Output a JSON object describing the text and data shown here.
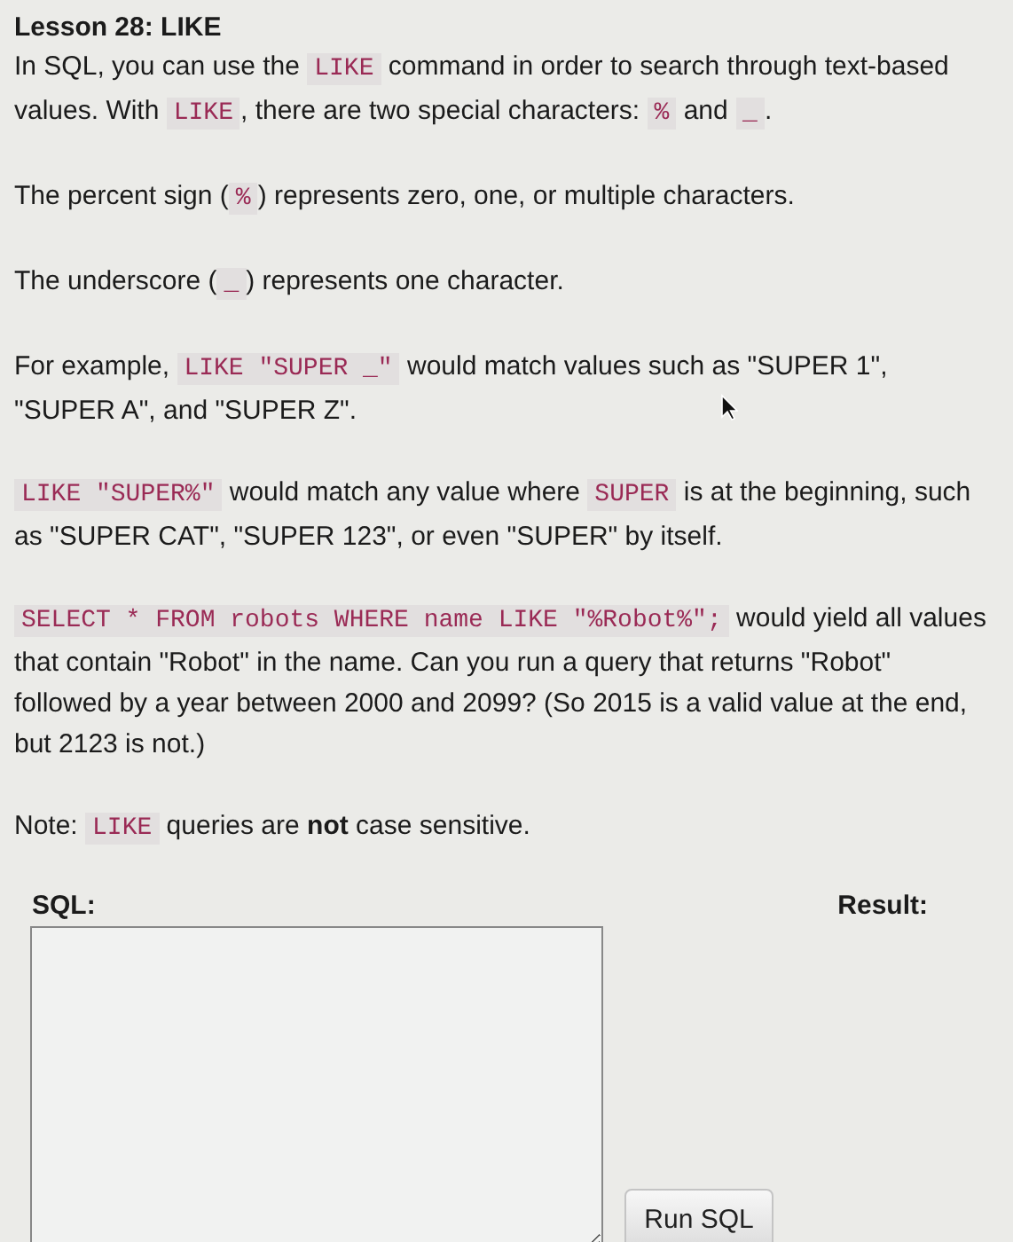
{
  "title": "Lesson 28: LIKE",
  "paragraphs": [
    {
      "segments": [
        {
          "kind": "text",
          "text": "In SQL, you can use the "
        },
        {
          "kind": "code",
          "text": "LIKE"
        },
        {
          "kind": "text",
          "text": " command in order to search through text-based values. With "
        },
        {
          "kind": "code",
          "text": "LIKE"
        },
        {
          "kind": "text",
          "text": ", there are two special characters: "
        },
        {
          "kind": "code",
          "text": "%"
        },
        {
          "kind": "text",
          "text": " and "
        },
        {
          "kind": "code",
          "text": "_"
        },
        {
          "kind": "text",
          "text": "."
        }
      ]
    },
    {
      "segments": [
        {
          "kind": "text",
          "text": "The percent sign ("
        },
        {
          "kind": "code",
          "text": "%"
        },
        {
          "kind": "text",
          "text": ") represents zero, one, or multiple characters."
        }
      ]
    },
    {
      "segments": [
        {
          "kind": "text",
          "text": "The underscore ("
        },
        {
          "kind": "code",
          "text": "_"
        },
        {
          "kind": "text",
          "text": ") represents one character."
        }
      ]
    },
    {
      "segments": [
        {
          "kind": "text",
          "text": "For example, "
        },
        {
          "kind": "code",
          "text": "LIKE \"SUPER _\""
        },
        {
          "kind": "text",
          "text": " would match values such as \"SUPER 1\", \"SUPER A\", and \"SUPER Z\"."
        }
      ]
    },
    {
      "segments": [
        {
          "kind": "code",
          "text": "LIKE \"SUPER%\""
        },
        {
          "kind": "text",
          "text": " would match any value where "
        },
        {
          "kind": "code",
          "text": "SUPER"
        },
        {
          "kind": "text",
          "text": " is at the beginning, such as \"SUPER CAT\", \"SUPER 123\", or even \"SUPER\" by itself."
        }
      ]
    },
    {
      "segments": [
        {
          "kind": "code",
          "text": "SELECT * FROM robots WHERE name LIKE \"%Robot%\";"
        },
        {
          "kind": "text",
          "text": " would yield all values that contain \"Robot\" in the name. Can you run a query that returns \"Robot\" followed by a year between 2000 and 2099? (So 2015 is a valid value at the end, but 2123 is not.)"
        }
      ]
    },
    {
      "segments": [
        {
          "kind": "text",
          "text": "Note: "
        },
        {
          "kind": "code",
          "text": "LIKE"
        },
        {
          "kind": "text",
          "text": " queries are "
        },
        {
          "kind": "bold",
          "text": "not"
        },
        {
          "kind": "text",
          "text": " case sensitive."
        }
      ]
    }
  ],
  "sql_label": "SQL:",
  "result_label": "Result:",
  "run_button": "Run SQL"
}
